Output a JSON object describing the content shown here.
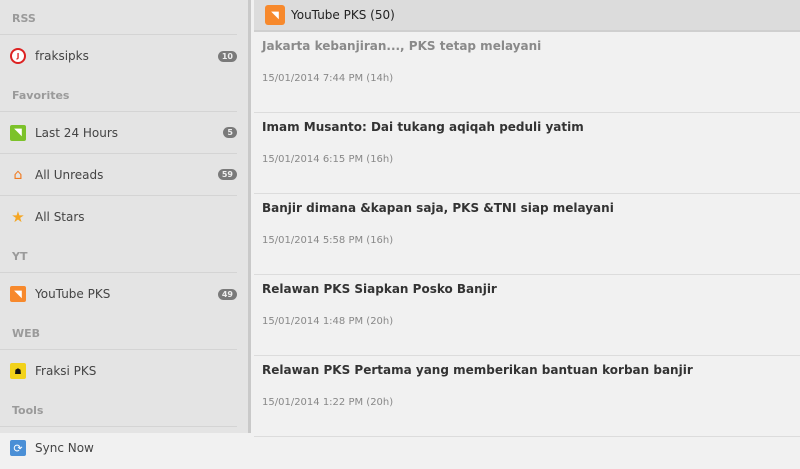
{
  "sidebar": {
    "sections": [
      {
        "title": "RSS",
        "items": [
          {
            "label": "fraksipks",
            "badge": "10",
            "icon": "fraksipks-logo-icon"
          }
        ]
      },
      {
        "title": "Favorites",
        "items": [
          {
            "label": "Last 24 Hours",
            "badge": "5",
            "icon": "rss-green-icon"
          },
          {
            "label": "All Unreads",
            "badge": "59",
            "icon": "unreads-icon"
          },
          {
            "label": "All Stars",
            "icon": "star-icon"
          }
        ]
      },
      {
        "title": "YT",
        "items": [
          {
            "label": "YouTube PKS",
            "badge": "49",
            "icon": "rss-icon"
          }
        ]
      },
      {
        "title": "WEB",
        "items": [
          {
            "label": "Fraksi PKS",
            "icon": "fraksi-pks-logo-icon"
          }
        ]
      },
      {
        "title": "Tools",
        "items": [
          {
            "label": "Sync Now",
            "icon": "sync-icon"
          }
        ]
      }
    ]
  },
  "header": {
    "title": "YouTube PKS (50)",
    "icon": "rss-icon"
  },
  "articles": [
    {
      "title": "Jakarta kebanjiran..., PKS tetap melayani",
      "date": "15/01/2014 7:44 PM (14h)",
      "read": true
    },
    {
      "title": "Imam Musanto: Dai tukang aqiqah peduli yatim",
      "date": "15/01/2014 6:15 PM (16h)"
    },
    {
      "title": "Banjir dimana &kapan saja, PKS &TNI siap melayani",
      "date": "15/01/2014 5:58 PM (16h)"
    },
    {
      "title": "Relawan PKS Siapkan Posko Banjir",
      "date": "15/01/2014 1:48 PM (20h)"
    },
    {
      "title": "Relawan PKS Pertama yang memberikan bantuan korban banjir",
      "date": "15/01/2014 1:22 PM (20h)"
    }
  ]
}
